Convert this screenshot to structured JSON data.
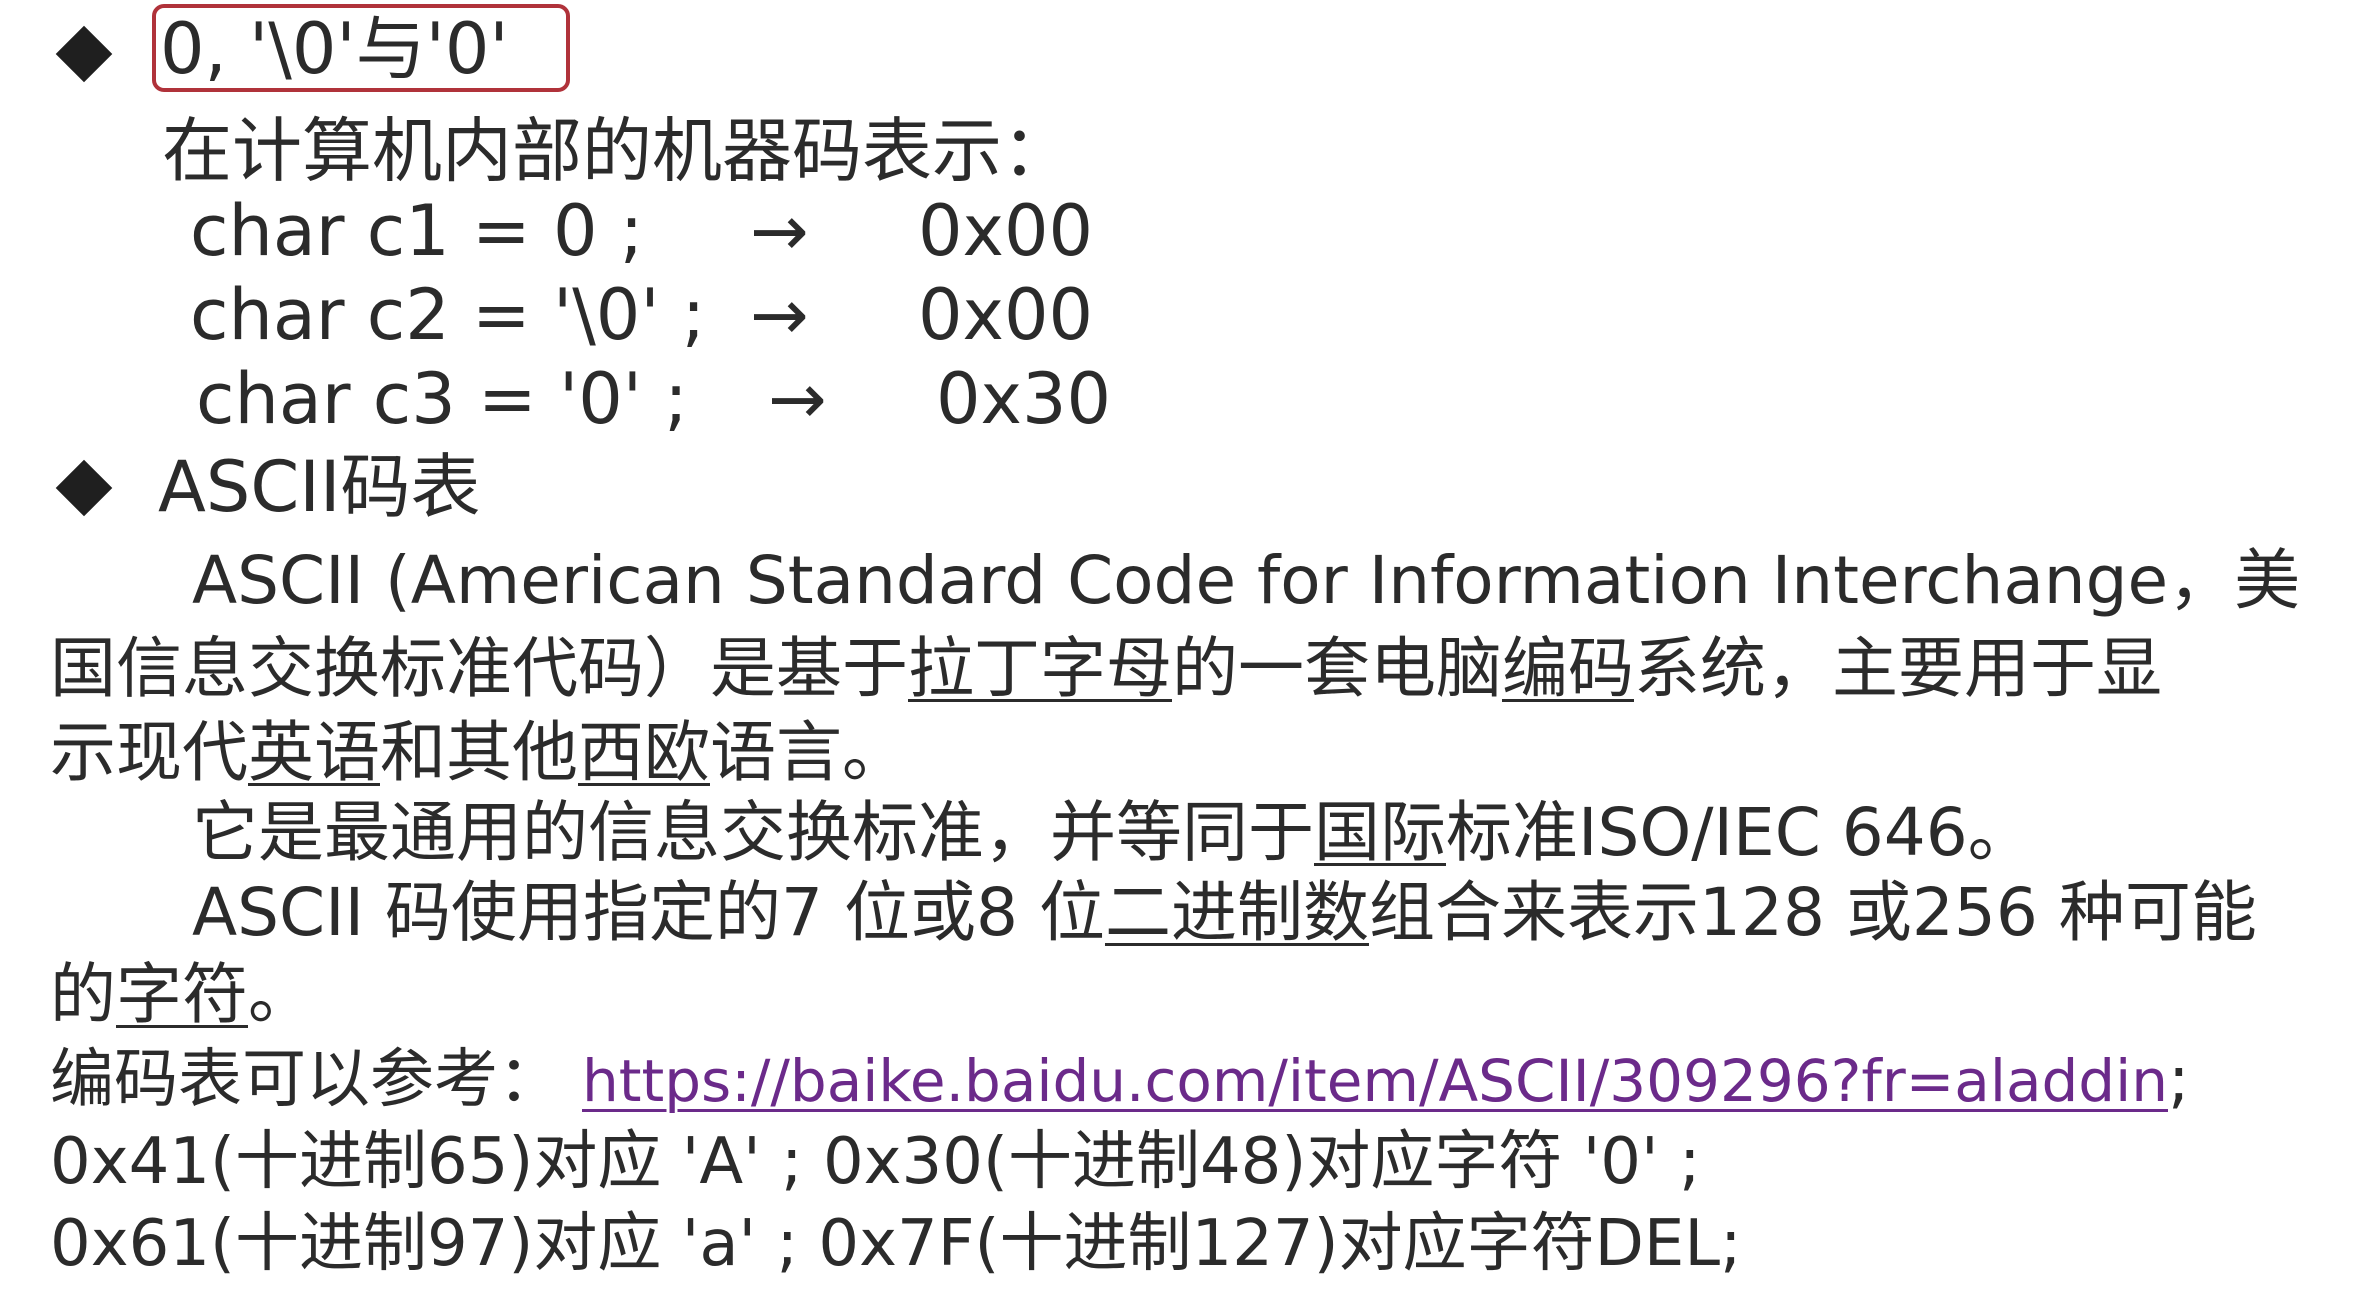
{
  "section1": {
    "title": "0,  '\\0'与'0'",
    "intro": "在计算机内部的机器码表示：",
    "rows": [
      {
        "code": "char c1  =  0 ;",
        "arrow": "→",
        "hex": "0x00"
      },
      {
        "code": "char c2  =   '\\0'  ;",
        "arrow": "→",
        "hex": "0x00"
      },
      {
        "code": "char c3  =    '0'  ;",
        "arrow": "→",
        "hex": "0x30"
      }
    ]
  },
  "section2": {
    "title": "ASCII码表",
    "p1_a": "ASCII (American Standard Code for Information Interchange，美",
    "p1_b_1": "国信息交换标准代码）是基于",
    "p1_b_2": "拉丁字母",
    "p1_b_3": "的一套电脑",
    "p1_b_4": "编码",
    "p1_b_5": "系统，主要用于显",
    "p1_c_1": "示现代",
    "p1_c_2": "英语",
    "p1_c_3": "和其他",
    "p1_c_4": "西欧",
    "p1_c_5": "语言。",
    "p2_1": "它是最通用的信息交换标准，并等同于",
    "p2_2": "国际",
    "p2_3": "标准ISO/IEC 646。",
    "p3_1": "ASCII 码使用指定的7 位或8 位",
    "p3_2": "二进制数",
    "p3_3": "组合来表示128 或256 种可能",
    "p3_4": "的",
    "p3_5": "字符",
    "p3_6": "。",
    "ref_label": "编码表可以参考：",
    "ref_url": "https://baike.baidu.com/item/ASCII/309296?fr=aladdin",
    "ref_end": ";",
    "ex1": "0x41(十进制65)对应 'A' ; 0x30(十进制48)对应字符 '0' ;",
    "ex2": "0x61(十进制97)对应 'a' ; 0x7F(十进制127)对应字符DEL;"
  }
}
